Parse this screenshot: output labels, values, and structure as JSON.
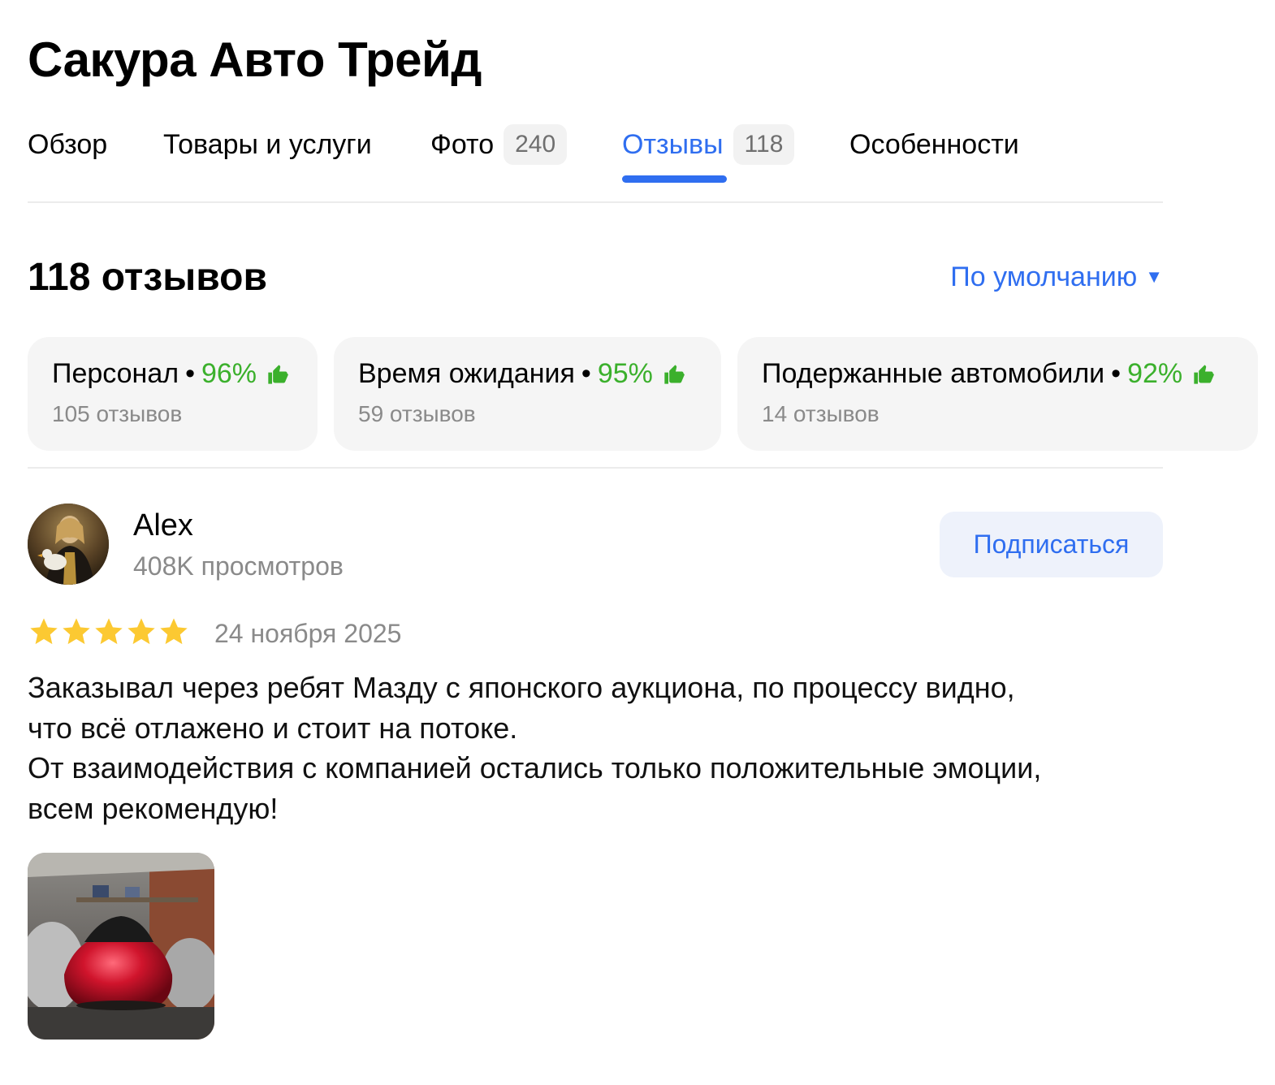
{
  "header": {
    "title": "Сакура Авто Трейд"
  },
  "tabs": [
    {
      "label": "Обзор"
    },
    {
      "label": "Товары и услуги"
    },
    {
      "label": "Фото",
      "count": "240"
    },
    {
      "label": "Отзывы",
      "count": "118"
    },
    {
      "label": "Особенности"
    }
  ],
  "active_tab": "Отзывы",
  "reviews": {
    "heading": "118 отзывов",
    "sort_label": "По умолчанию",
    "sort_icon": "caret-down-icon"
  },
  "aspects": [
    {
      "name": "Персонал",
      "percent": "96%",
      "count": "105 отзывов",
      "icon": "thumbs-up-icon"
    },
    {
      "name": "Время ожидания",
      "percent": "95%",
      "count": "59 отзывов",
      "icon": "thumbs-up-icon"
    },
    {
      "name": "Подержанные автомобили",
      "percent": "92%",
      "count": "14 отзывов",
      "icon": "thumbs-up-icon"
    }
  ],
  "review": {
    "author": "Alex",
    "views": "408K просмотров",
    "subscribe_label": "Подписаться",
    "rating": 5,
    "max_rating": 5,
    "date": "24 ноября 2025",
    "text_lines": [
      "Заказывал через ребят Мазду с японского аукциона, по процессу видно,",
      "что всё отлажено и стоит на потоке.",
      "От взаимодействия с компанией остались только положительные эмоции,",
      "всем рекомендую!"
    ]
  },
  "colors": {
    "accent": "#2f6ef0",
    "positive": "#3bb02c",
    "star": "#fcc932",
    "muted": "#8a8a8a",
    "chip_bg": "#f5f5f5"
  }
}
